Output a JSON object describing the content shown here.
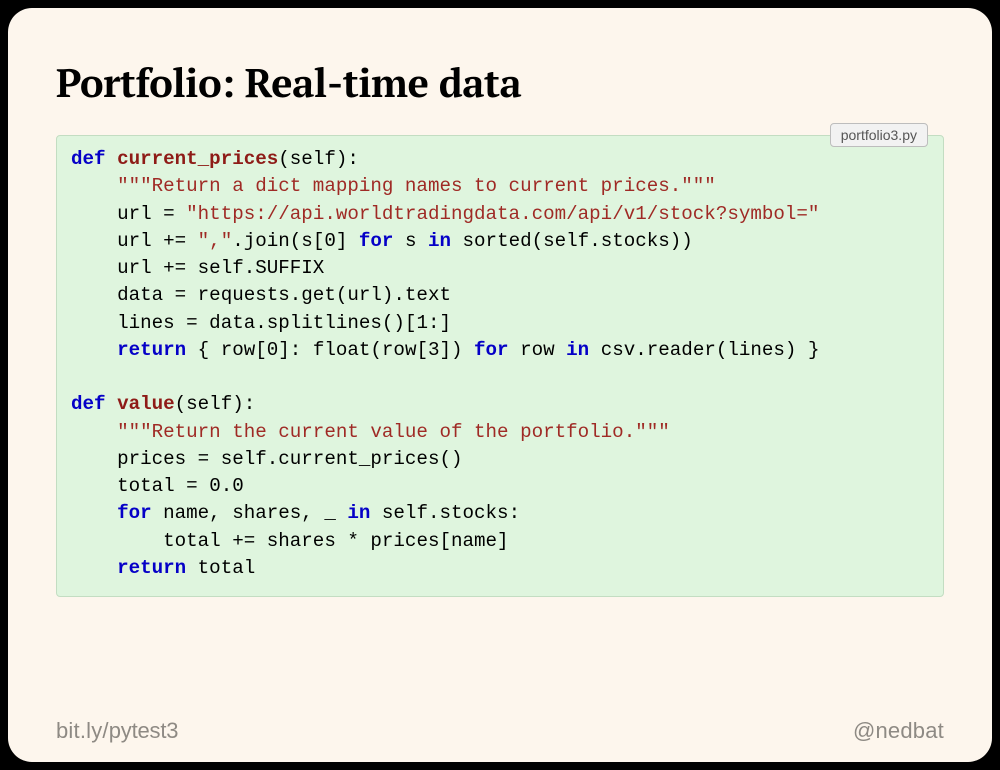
{
  "slide": {
    "title": "Portfolio: Real-time data",
    "filename": "portfolio3.py"
  },
  "code": {
    "fn1": {
      "def": "def",
      "name": "current_prices",
      "sig_open": "(",
      "self": "self",
      "sig_close": "):",
      "doc": "\"\"\"Return a dict mapping names to current prices.\"\"\"",
      "l1a": "url = ",
      "l1b": "\"https://api.worldtradingdata.com/api/v1/stock?symbol=\"",
      "l2a": "url += ",
      "l2b": "\",\"",
      "l2c": ".join(s[",
      "l2d": "0",
      "l2e": "] ",
      "l2f": "for",
      "l2g": " s ",
      "l2h": "in",
      "l2i": " sorted(self.stocks))",
      "l3": "url += self.SUFFIX",
      "l4": "data = requests.get(url).text",
      "l5a": "lines = data.splitlines()[",
      "l5b": "1",
      "l5c": ":]",
      "l6a": "return",
      "l6b": " { row[",
      "l6c": "0",
      "l6d": "]: float(row[",
      "l6e": "3",
      "l6f": "]) ",
      "l6g": "for",
      "l6h": " row ",
      "l6i": "in",
      "l6j": " csv.reader(lines) }"
    },
    "fn2": {
      "def": "def",
      "name": "value",
      "sig_open": "(",
      "self": "self",
      "sig_close": "):",
      "doc": "\"\"\"Return the current value of the portfolio.\"\"\"",
      "l1": "prices = self.current_prices()",
      "l2a": "total = ",
      "l2b": "0.0",
      "l3a": "for",
      "l3b": " name, shares, _ ",
      "l3c": "in",
      "l3d": " self.stocks:",
      "l4": "total += shares * prices[name]",
      "l5a": "return",
      "l5b": " total"
    }
  },
  "footer": {
    "left_prefix": "bit.ly/",
    "left_slug": "pytest3",
    "right": "@nedbat"
  }
}
